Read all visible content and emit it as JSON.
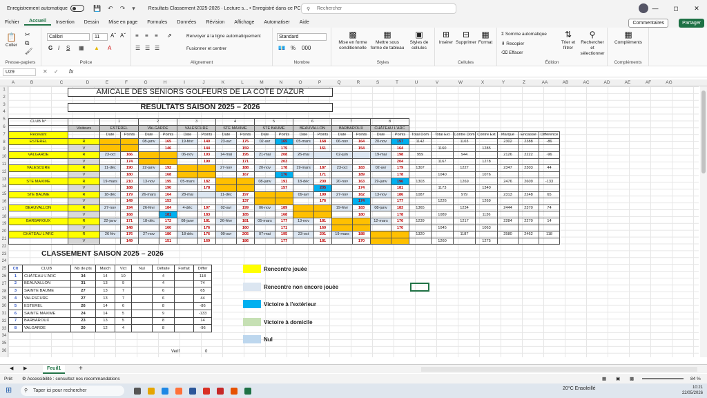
{
  "title_bar": {
    "autosave": "Enregistrement automatique",
    "doc": "Resultats Classement 2025-2026 · Lecture s...  • Enregistré dans ce PC",
    "search": "Rechercher"
  },
  "menu": [
    "Fichier",
    "Accueil",
    "Insertion",
    "Dessin",
    "Mise en page",
    "Formules",
    "Données",
    "Révision",
    "Affichage",
    "Automatiser",
    "Aide"
  ],
  "menu_active": "Accueil",
  "comments_label": "Commentaires",
  "share_label": "Partager",
  "ribbon": {
    "clipboard": {
      "label": "Presse-papiers",
      "coller": "Coller"
    },
    "police": {
      "label": "Police",
      "font": "Calibri",
      "size": "11"
    },
    "alignement": {
      "label": "Alignement",
      "wrap": "Renvoyer à la ligne automatiquement",
      "merge": "Fusionner et centrer"
    },
    "nombre": {
      "label": "Nombre",
      "format": "Standard"
    },
    "styles": {
      "label": "Styles",
      "mfc": "Mise en forme conditionnelle",
      "table": "Mettre sous forme de tableau",
      "cell": "Styles de cellules"
    },
    "cellules": {
      "label": "Cellules",
      "insert": "Insérer",
      "delete": "Supprimer",
      "format": "Format"
    },
    "edition": {
      "label": "Édition",
      "sum": "Somme automatique",
      "fill": "Recopier",
      "clear": "Effacer",
      "sort": "Trier et filtrer",
      "find": "Rechercher et sélectionner"
    },
    "complements": {
      "label": "Compléments",
      "btn": "Compléments"
    }
  },
  "name_box": "U29",
  "fx": "fx",
  "columns": [
    "A",
    "B",
    "C",
    "D",
    "E",
    "F",
    "G",
    "H",
    "I",
    "J",
    "K",
    "L",
    "M",
    "N",
    "O",
    "P",
    "Q",
    "R",
    "S",
    "T",
    "U",
    "V",
    "W",
    "X",
    "Y",
    "Z",
    "AA",
    "AB",
    "AC",
    "AD",
    "AE",
    "AF",
    "AG"
  ],
  "rows": [
    "1",
    "2",
    "3",
    "4",
    "5",
    "6",
    "7",
    "8",
    "9",
    "10",
    "11",
    "12",
    "13",
    "14",
    "15",
    "16",
    "17",
    "18",
    "19",
    "20",
    "21",
    "22",
    "23",
    "24",
    "25",
    "26",
    "27",
    "28",
    "29",
    "30",
    "31",
    "32",
    "33",
    "34",
    "35",
    "36"
  ],
  "titles": {
    "t1": "AMICALE DES SENIORS GOLFEURS DE LA COTE D'AZUR",
    "t2": "RESULTATS SAISON 2025 – 2026",
    "classement": "CLASSEMENT SAISON 2025 – 2026"
  },
  "results": {
    "club_no": "CLUB N°",
    "visiteurs": "Visiteurs",
    "nums": [
      "1",
      "2",
      "3",
      "4",
      "5",
      "6",
      "7",
      "8"
    ],
    "clubs": [
      "ESTEREL",
      "VALGARDE",
      "VALESCURE",
      "STE MAXIME",
      "STE BAUME",
      "BEAUVALLON",
      "BARBAROUX",
      "CHÂTEAU L'ARC"
    ],
    "recevant": "Recevant",
    "date": "Date",
    "points": "Points",
    "sum_heads": [
      "Total Dom",
      "Total Ext",
      "Contre Dom",
      "Contre Ext",
      "Marqué",
      "Encaissé",
      "Différence"
    ],
    "rows": [
      {
        "club": "ESTEREL",
        "rv": "R",
        "cells": [
          [
            "",
            ""
          ],
          [
            "08-janv",
            "165"
          ],
          [
            "19-févr",
            "140"
          ],
          [
            "23-avr",
            "175"
          ],
          [
            "02-avr",
            "165"
          ],
          [
            "05-mars",
            "168"
          ],
          [
            "06-nov",
            "164"
          ],
          [
            "20-nov",
            "157"
          ]
        ],
        "sums": [
          "1142",
          "",
          "1103",
          "",
          "2302",
          "2388",
          "-86"
        ]
      },
      {
        "club": "",
        "rv": "V",
        "cells": [
          [
            "",
            ""
          ],
          [
            "",
            "146"
          ],
          [
            "",
            "144"
          ],
          [
            "",
            "159"
          ],
          [
            "",
            "175"
          ],
          [
            "",
            "161"
          ],
          [
            "",
            "154"
          ],
          [
            "",
            "164"
          ]
        ],
        "sums": [
          "",
          "1160",
          "",
          "1285",
          "",
          "",
          ""
        ]
      },
      {
        "club": "VALGARDE",
        "rv": "R",
        "cells": [
          [
            "23-oct",
            "166"
          ],
          [
            "",
            ""
          ],
          [
            "06-nov",
            "193"
          ],
          [
            "14-mai",
            "195"
          ],
          [
            "21-mai",
            "208"
          ],
          [
            "26-mai",
            ""
          ],
          [
            "02-juin",
            ""
          ],
          [
            "19-mai",
            "198"
          ]
        ],
        "sums": [
          "959",
          "",
          "944",
          "",
          "2126",
          "2222",
          "-96"
        ]
      },
      {
        "club": "",
        "rv": "V",
        "cells": [
          [
            "",
            "174"
          ],
          [
            "",
            ""
          ],
          [
            "",
            "190"
          ],
          [
            "",
            "171"
          ],
          [
            "",
            "203"
          ],
          [
            "",
            ""
          ],
          [
            "",
            ""
          ],
          [
            "",
            "204"
          ]
        ],
        "sums": [
          "",
          "1167",
          "",
          "1278",
          "",
          "",
          ""
        ]
      },
      {
        "club": "VALESCURE",
        "rv": "R",
        "cells": [
          [
            "11-déc",
            "190"
          ],
          [
            "22-janv",
            "192"
          ],
          [
            "",
            ""
          ],
          [
            "27-nov",
            "188"
          ],
          [
            "20-nov",
            "178"
          ],
          [
            "19-mars",
            "187"
          ],
          [
            "23-oct",
            "183"
          ],
          [
            "02-avr",
            "179"
          ]
        ],
        "sums": [
          "1307",
          "",
          "1227",
          "",
          "2347",
          "2303",
          "44"
        ]
      },
      {
        "club": "",
        "rv": "V",
        "cells": [
          [
            "",
            "180"
          ],
          [
            "",
            "168"
          ],
          [
            "",
            ""
          ],
          [
            "",
            "167"
          ],
          [
            "",
            "176"
          ],
          [
            "",
            "171"
          ],
          [
            "",
            "189"
          ],
          [
            "",
            "178"
          ]
        ],
        "sums": [
          "",
          "1040",
          "",
          "1076",
          "",
          "",
          ""
        ]
      },
      {
        "club": "STE MAXIME",
        "rv": "R",
        "cells": [
          [
            "19-mars",
            "210"
          ],
          [
            "13-nov",
            "195"
          ],
          [
            "05-mars",
            "182"
          ],
          [
            "",
            ""
          ],
          [
            "08-janv",
            "191"
          ],
          [
            "18-déc",
            "200"
          ],
          [
            "20-nov",
            "163"
          ],
          [
            "29-janv",
            "196"
          ]
        ],
        "sums": [
          "1303",
          "",
          "1269",
          "",
          "2476",
          "2609",
          "-133"
        ]
      },
      {
        "club": "",
        "rv": "V",
        "cells": [
          [
            "",
            "188"
          ],
          [
            "",
            "190"
          ],
          [
            "",
            "178"
          ],
          [
            "",
            ""
          ],
          [
            "",
            "157"
          ],
          [
            "",
            "205"
          ],
          [
            "",
            "174"
          ],
          [
            "",
            "181"
          ]
        ],
        "sums": [
          "",
          "1173",
          "",
          "1340",
          "",
          "",
          ""
        ]
      },
      {
        "club": "STE BAUME",
        "rv": "R",
        "cells": [
          [
            "18-déc",
            "179"
          ],
          [
            "26-mars",
            "164"
          ],
          [
            "28-mai",
            ""
          ],
          [
            "11-déc",
            "197"
          ],
          [
            "",
            ""
          ],
          [
            "09-avr",
            "199"
          ],
          [
            "27-nov",
            "162"
          ],
          [
            "13-nov",
            "186"
          ]
        ],
        "sums": [
          "1087",
          "",
          "979",
          "",
          "2313",
          "2248",
          "65"
        ]
      },
      {
        "club": "",
        "rv": "V",
        "cells": [
          [
            "",
            "149"
          ],
          [
            "",
            "153"
          ],
          [
            "",
            ""
          ],
          [
            "",
            "137"
          ],
          [
            "",
            ""
          ],
          [
            "",
            "176"
          ],
          [
            "",
            "174"
          ],
          [
            "",
            "177"
          ]
        ],
        "sums": [
          "",
          "1226",
          "",
          "1269",
          "",
          "",
          ""
        ]
      },
      {
        "club": "BEAUVALLON",
        "rv": "R",
        "cells": [
          [
            "27-nov",
            "194"
          ],
          [
            "26-févr",
            "184"
          ],
          [
            "4-déc",
            "197"
          ],
          [
            "02-avr",
            "199"
          ],
          [
            "06-nov",
            "189"
          ],
          [
            "",
            ""
          ],
          [
            "19-févr",
            "183"
          ],
          [
            "08-janv",
            "183"
          ]
        ],
        "sums": [
          "1365",
          "",
          "1234",
          "",
          "2444",
          "2370",
          "74"
        ]
      },
      {
        "club": "",
        "rv": "V",
        "cells": [
          [
            "",
            "168"
          ],
          [
            "",
            "181"
          ],
          [
            "",
            "183"
          ],
          [
            "",
            "185"
          ],
          [
            "",
            "168"
          ],
          [
            "",
            ""
          ],
          [
            "",
            "180"
          ],
          [
            "",
            "178"
          ]
        ],
        "sums": [
          "",
          "1089",
          "",
          "1136",
          "",
          "",
          ""
        ]
      },
      {
        "club": "BARBAROUX",
        "rv": "R",
        "cells": [
          [
            "22-janv",
            "171"
          ],
          [
            "18-déc",
            "172"
          ],
          [
            "08-janv",
            "181"
          ],
          [
            "26-févr",
            "181"
          ],
          [
            "05-mars",
            "177"
          ],
          [
            "13-nov",
            "181"
          ],
          [
            "",
            ""
          ],
          [
            "12-mars",
            "176"
          ]
        ],
        "sums": [
          "1239",
          "",
          "1217",
          "",
          "2284",
          "2270",
          "14"
        ]
      },
      {
        "club": "",
        "rv": "V",
        "cells": [
          [
            "",
            "148"
          ],
          [
            "",
            "160"
          ],
          [
            "",
            "176"
          ],
          [
            "",
            "160"
          ],
          [
            "",
            "171"
          ],
          [
            "",
            "160"
          ],
          [
            "",
            ""
          ],
          [
            "",
            "170"
          ]
        ],
        "sums": [
          "",
          "1045",
          "",
          "1063",
          "",
          "",
          ""
        ]
      },
      {
        "club": "CHÂTEAU L'ARC",
        "rv": "R",
        "cells": [
          [
            "26 fév",
            "176"
          ],
          [
            "27-nov",
            "186"
          ],
          [
            "18-déc",
            "176"
          ],
          [
            "09-avr",
            "205"
          ],
          [
            "07-mai",
            "195"
          ],
          [
            "23-oct",
            "201"
          ],
          [
            "19-mars",
            "188"
          ],
          [
            "",
            ""
          ]
        ],
        "sums": [
          "1320",
          "",
          "1187",
          "",
          "2580",
          "2462",
          "118"
        ]
      },
      {
        "club": "",
        "rv": "V",
        "cells": [
          [
            "",
            "149"
          ],
          [
            "",
            "151"
          ],
          [
            "",
            "169"
          ],
          [
            "",
            "186"
          ],
          [
            "",
            "177"
          ],
          [
            "",
            "181"
          ],
          [
            "",
            "170"
          ],
          [
            "",
            ""
          ]
        ],
        "sums": [
          "",
          "1260",
          "",
          "1275",
          "",
          "",
          ""
        ]
      }
    ]
  },
  "standings": {
    "headers": [
      "Clt",
      "CLUB",
      "Nb de pts",
      "Match",
      "Vict",
      "Nul",
      "Défaite",
      "Forfait",
      "Differ"
    ],
    "rows": [
      [
        "1",
        "CHÂTEAU L'ARC",
        "34",
        "14",
        "10",
        "",
        "4",
        "",
        "118"
      ],
      [
        "2",
        "BEAUVALLON",
        "31",
        "13",
        "9",
        "",
        "4",
        "",
        "74"
      ],
      [
        "3",
        "SAINTE BAUME",
        "27",
        "13",
        "7",
        "",
        "6",
        "",
        "65"
      ],
      [
        "4",
        "VALESCURE",
        "27",
        "13",
        "7",
        "",
        "6",
        "",
        "44"
      ],
      [
        "5",
        "ESTEREL",
        "26",
        "14",
        "6",
        "",
        "8",
        "",
        "-86"
      ],
      [
        "6",
        "SAINTE MAXIME",
        "24",
        "14",
        "5",
        "",
        "9",
        "",
        "-133"
      ],
      [
        "7",
        "BARBAROUX",
        "23",
        "13",
        "5",
        "",
        "8",
        "",
        "14"
      ],
      [
        "8",
        "VALGARDE",
        "20",
        "12",
        "4",
        "",
        "8",
        "",
        "-96"
      ]
    ],
    "verif": "Verif",
    "verif_val": "0"
  },
  "legend": [
    "Rencontre jouée",
    "Rencontre non encore jouée",
    "Victoire à l'extérieur",
    "Victoire à domicile",
    "Nul"
  ],
  "legend_colors": [
    "#ffff00",
    "#dce6f1",
    "#00b0f0",
    "#c6e0b4",
    "#bdd7ee"
  ],
  "sheet_tab": "Feuil1",
  "status": {
    "ready": "Prêt",
    "access": "Accessibilité : consultez nos recommandations",
    "zoom": "84 %"
  },
  "taskbar": {
    "search": "Taper ici pour rechercher",
    "weather": "20°C Ensoleillé",
    "time": "10:21",
    "date": "22/05/2026"
  }
}
